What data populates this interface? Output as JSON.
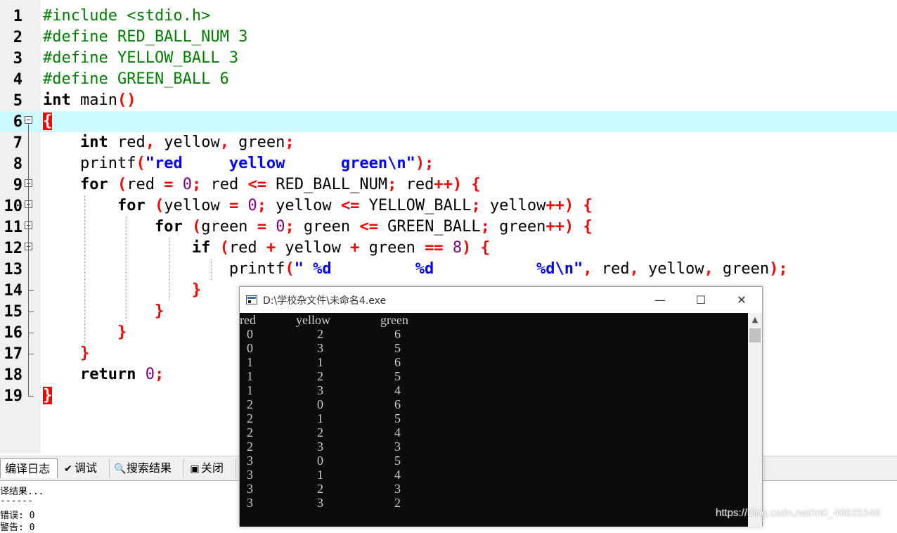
{
  "editor": {
    "current_line": 6,
    "lines": [
      {
        "n": "1",
        "tokens": [
          {
            "t": "#include <stdio.h>",
            "c": "pp"
          }
        ]
      },
      {
        "n": "2",
        "tokens": [
          {
            "t": "#define RED_BALL_NUM 3",
            "c": "pp"
          }
        ]
      },
      {
        "n": "3",
        "tokens": [
          {
            "t": "#define YELLOW_BALL 3",
            "c": "pp"
          }
        ]
      },
      {
        "n": "4",
        "tokens": [
          {
            "t": "#define GREEN_BALL 6",
            "c": "pp"
          }
        ]
      },
      {
        "n": "5",
        "tokens": [
          {
            "t": "int",
            "c": "kw"
          },
          {
            "t": " main"
          },
          {
            "t": "()",
            "c": "op"
          }
        ]
      },
      {
        "n": "6",
        "fold": true,
        "tokens": [
          {
            "t": "{",
            "c": "brace-hl"
          }
        ]
      },
      {
        "n": "7",
        "tokens": [
          {
            "t": "    "
          },
          {
            "t": "int",
            "c": "kw"
          },
          {
            "t": " red"
          },
          {
            "t": ",",
            "c": "op"
          },
          {
            "t": " yellow"
          },
          {
            "t": ",",
            "c": "op"
          },
          {
            "t": " green"
          },
          {
            "t": ";",
            "c": "op"
          }
        ]
      },
      {
        "n": "8",
        "tokens": [
          {
            "t": "    printf"
          },
          {
            "t": "(",
            "c": "op"
          },
          {
            "t": "\"red     yellow      green\\n\"",
            "c": "str"
          },
          {
            "t": ");",
            "c": "op"
          }
        ]
      },
      {
        "n": "9",
        "fold": true,
        "tokens": [
          {
            "t": "    "
          },
          {
            "t": "for",
            "c": "kw"
          },
          {
            "t": " "
          },
          {
            "t": "(",
            "c": "op"
          },
          {
            "t": "red "
          },
          {
            "t": "=",
            "c": "op"
          },
          {
            "t": " "
          },
          {
            "t": "0",
            "c": "num"
          },
          {
            "t": ";",
            "c": "op"
          },
          {
            "t": " red "
          },
          {
            "t": "<=",
            "c": "op"
          },
          {
            "t": " RED_BALL_NUM"
          },
          {
            "t": ";",
            "c": "op"
          },
          {
            "t": " red"
          },
          {
            "t": "++)",
            "c": "op"
          },
          {
            "t": " "
          },
          {
            "t": "{",
            "c": "op"
          }
        ]
      },
      {
        "n": "10",
        "fold": true,
        "tokens": [
          {
            "t": "        "
          },
          {
            "t": "for",
            "c": "kw"
          },
          {
            "t": " "
          },
          {
            "t": "(",
            "c": "op"
          },
          {
            "t": "yellow "
          },
          {
            "t": "=",
            "c": "op"
          },
          {
            "t": " "
          },
          {
            "t": "0",
            "c": "num"
          },
          {
            "t": ";",
            "c": "op"
          },
          {
            "t": " yellow "
          },
          {
            "t": "<=",
            "c": "op"
          },
          {
            "t": " YELLOW_BALL"
          },
          {
            "t": ";",
            "c": "op"
          },
          {
            "t": " yellow"
          },
          {
            "t": "++)",
            "c": "op"
          },
          {
            "t": " "
          },
          {
            "t": "{",
            "c": "op"
          }
        ]
      },
      {
        "n": "11",
        "fold": true,
        "tokens": [
          {
            "t": "            "
          },
          {
            "t": "for",
            "c": "kw"
          },
          {
            "t": " "
          },
          {
            "t": "(",
            "c": "op"
          },
          {
            "t": "green "
          },
          {
            "t": "=",
            "c": "op"
          },
          {
            "t": " "
          },
          {
            "t": "0",
            "c": "num"
          },
          {
            "t": ";",
            "c": "op"
          },
          {
            "t": " green "
          },
          {
            "t": "<=",
            "c": "op"
          },
          {
            "t": " GREEN_BALL"
          },
          {
            "t": ";",
            "c": "op"
          },
          {
            "t": " green"
          },
          {
            "t": "++)",
            "c": "op"
          },
          {
            "t": " "
          },
          {
            "t": "{",
            "c": "op"
          }
        ]
      },
      {
        "n": "12",
        "fold": true,
        "tokens": [
          {
            "t": "                "
          },
          {
            "t": "if",
            "c": "kw"
          },
          {
            "t": " "
          },
          {
            "t": "(",
            "c": "op"
          },
          {
            "t": "red "
          },
          {
            "t": "+",
            "c": "op"
          },
          {
            "t": " yellow "
          },
          {
            "t": "+",
            "c": "op"
          },
          {
            "t": " green "
          },
          {
            "t": "==",
            "c": "op"
          },
          {
            "t": " "
          },
          {
            "t": "8",
            "c": "num"
          },
          {
            "t": ")",
            "c": "op"
          },
          {
            "t": " "
          },
          {
            "t": "{",
            "c": "op"
          }
        ]
      },
      {
        "n": "13",
        "tokens": [
          {
            "t": "                    printf"
          },
          {
            "t": "(",
            "c": "op"
          },
          {
            "t": "\" %d         %d           %d\\n\"",
            "c": "str"
          },
          {
            "t": ",",
            "c": "op"
          },
          {
            "t": " red"
          },
          {
            "t": ",",
            "c": "op"
          },
          {
            "t": " yellow"
          },
          {
            "t": ",",
            "c": "op"
          },
          {
            "t": " green"
          },
          {
            "t": ");",
            "c": "op"
          }
        ]
      },
      {
        "n": "14",
        "tokens": [
          {
            "t": "                "
          },
          {
            "t": "}",
            "c": "op"
          }
        ]
      },
      {
        "n": "15",
        "tokens": [
          {
            "t": "            "
          },
          {
            "t": "}",
            "c": "op"
          }
        ]
      },
      {
        "n": "16",
        "tokens": [
          {
            "t": "        "
          },
          {
            "t": "}",
            "c": "op"
          }
        ]
      },
      {
        "n": "17",
        "tokens": [
          {
            "t": "    "
          },
          {
            "t": "}",
            "c": "op"
          }
        ]
      },
      {
        "n": "18",
        "tokens": [
          {
            "t": "    "
          },
          {
            "t": "return",
            "c": "kw"
          },
          {
            "t": " "
          },
          {
            "t": "0",
            "c": "num"
          },
          {
            "t": ";",
            "c": "op"
          }
        ]
      },
      {
        "n": "19",
        "tokens": [
          {
            "t": "}",
            "c": "brace-hl"
          }
        ]
      }
    ]
  },
  "bottom_tabs": [
    {
      "label": "编译日志",
      "icon": "compile-log-icon",
      "glyph": "▦",
      "active": true
    },
    {
      "label": "调试",
      "icon": "debug-check-icon",
      "glyph": "✔",
      "active": false
    },
    {
      "label": "搜索结果",
      "icon": "search-results-icon",
      "glyph": "🔍",
      "active": false
    },
    {
      "label": "关闭",
      "icon": "close-panel-icon",
      "glyph": "▣",
      "active": false
    }
  ],
  "log_lines": [
    "译结果...",
    "------",
    "错误: 0",
    "警告: 0"
  ],
  "console": {
    "title": "D:\\学校杂文件\\未命名4.exe",
    "buttons": {
      "minimize": "—",
      "maximize": "☐",
      "close": "✕"
    },
    "header": [
      "red",
      "yellow",
      "green"
    ],
    "rows": [
      [
        "0",
        "2",
        "6"
      ],
      [
        "0",
        "3",
        "5"
      ],
      [
        "1",
        "1",
        "6"
      ],
      [
        "1",
        "2",
        "5"
      ],
      [
        "1",
        "3",
        "4"
      ],
      [
        "2",
        "0",
        "6"
      ],
      [
        "2",
        "1",
        "5"
      ],
      [
        "2",
        "2",
        "4"
      ],
      [
        "2",
        "3",
        "3"
      ],
      [
        "3",
        "0",
        "5"
      ],
      [
        "3",
        "1",
        "4"
      ],
      [
        "3",
        "2",
        "3"
      ],
      [
        "3",
        "3",
        "2"
      ]
    ],
    "scroll_up": "▲"
  },
  "watermark": "https://blog.csdn.net/m0_46625346",
  "colors": {
    "current_line": "#cdfaff",
    "keyword": "#000000",
    "preprocessor": "#008000",
    "operator": "#ff0000",
    "number": "#800080",
    "string": "#0000ff",
    "console_bg": "#0c0c0c",
    "console_fg": "#cccccc"
  }
}
